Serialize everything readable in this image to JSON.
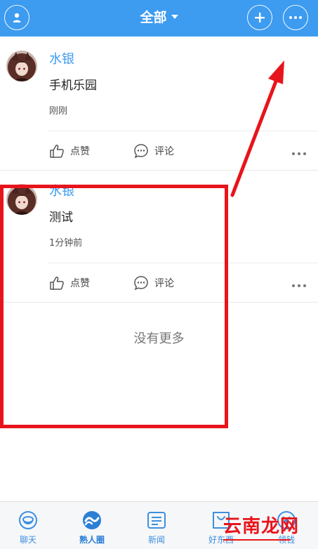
{
  "header": {
    "title": "全部",
    "avatar_icon": "user-icon",
    "add_icon": "plus-icon",
    "more_icon": "more-icon",
    "background": "#3d9bf0"
  },
  "posts": [
    {
      "author": "水银",
      "content": "手机乐园",
      "time": "刚刚",
      "like_label": "点赞",
      "comment_label": "评论"
    },
    {
      "author": "水银",
      "content": "测试",
      "time": "1分钟前",
      "like_label": "点赞",
      "comment_label": "评论"
    }
  ],
  "feed": {
    "no_more": "没有更多"
  },
  "bottom_nav": {
    "items": [
      {
        "label": "聊天",
        "icon": "chat-bubble-icon"
      },
      {
        "label": "熟人圈",
        "icon": "moments-icon"
      },
      {
        "label": "新闻",
        "icon": "news-icon"
      },
      {
        "label": "好东西",
        "icon": "shopping-bag-icon"
      },
      {
        "label": "领钱",
        "icon": "coin-icon"
      }
    ]
  },
  "watermark": {
    "text": "云南龙网"
  },
  "colors": {
    "accent": "#3d9bf0",
    "annotation": "#e8141b"
  }
}
